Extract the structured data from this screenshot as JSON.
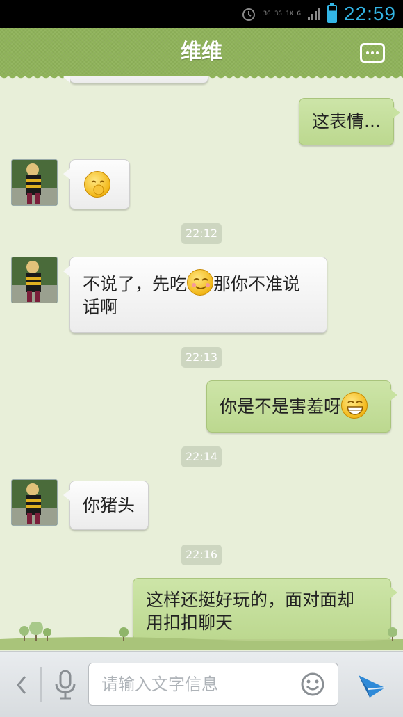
{
  "status_bar": {
    "network_top": "3G 3G 1X G",
    "time": "22:59",
    "icons": [
      "alarm-icon",
      "network-icon",
      "signal-icon",
      "battery-charging-icon"
    ]
  },
  "header": {
    "title": "维维",
    "menu_icon": "more-icon"
  },
  "messages": [
    {
      "side": "right",
      "type": "text",
      "text": "这表情..."
    },
    {
      "side": "left",
      "type": "emoji",
      "emoji": "shy-emoji"
    },
    {
      "type": "timestamp",
      "text": "22:12"
    },
    {
      "side": "left",
      "type": "text",
      "text_a": "不说了，先吃",
      "emoji": "smile-emoji",
      "text_b": "那你不准说",
      "text_c": "话啊"
    },
    {
      "type": "timestamp",
      "text": "22:13"
    },
    {
      "side": "right",
      "type": "text",
      "text": "你是不是害羞呀",
      "emoji": "grin-emoji"
    },
    {
      "type": "timestamp",
      "text": "22:14"
    },
    {
      "side": "left",
      "type": "text",
      "text": "你猪头"
    },
    {
      "type": "timestamp",
      "text": "22:16"
    },
    {
      "side": "right",
      "type": "text",
      "line1": "这样还挺好玩的，面对面却",
      "line2": "用扣扣聊天"
    }
  ],
  "input_bar": {
    "placeholder": "请输入文字信息",
    "icons": [
      "back-icon",
      "microphone-icon",
      "smiley-icon",
      "send-icon"
    ]
  },
  "colors": {
    "header_green": "#8fb35a",
    "chat_bg": "#e8efd9",
    "right_bubble": "#c8e2a0",
    "time_blue": "#33b5e5"
  }
}
